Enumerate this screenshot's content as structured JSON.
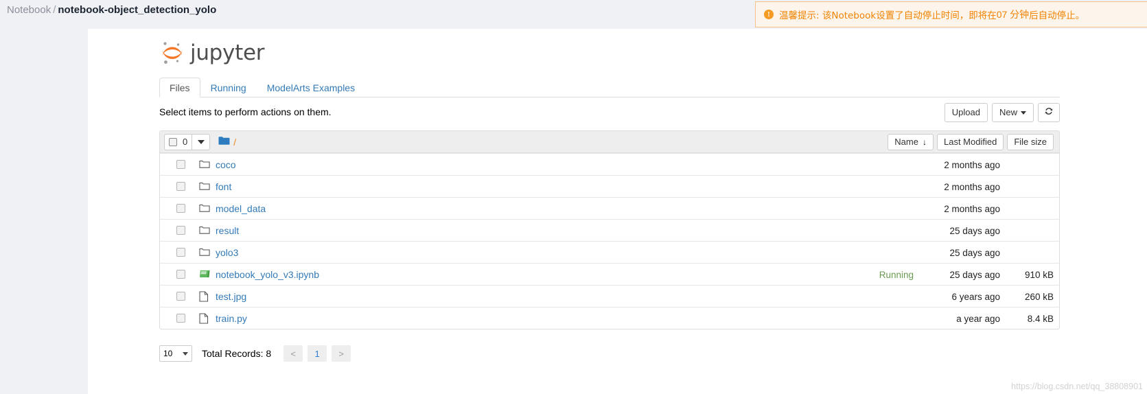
{
  "breadcrumb": {
    "root": "Notebook",
    "separator": "/",
    "current": "notebook-object_detection_yolo"
  },
  "notice": {
    "icon": "warning-exclamation-icon",
    "text_before": "温馨提示: 该Notebook设置了自动停止时间，即将在 ",
    "minutes": "07 分钟",
    "text_after": " 后自动停止。",
    "color": "#f08300",
    "background": "#fdf4ec",
    "border_color": "#f5c28b"
  },
  "brand": {
    "name": "jupyter",
    "logo_color": "#f37726",
    "dot_color": "#9e9e9e"
  },
  "tabs": [
    {
      "label": "Files",
      "active": true
    },
    {
      "label": "Running",
      "active": false
    },
    {
      "label": "ModelArts Examples",
      "active": false
    }
  ],
  "toolbar": {
    "select_hint": "Select items to perform actions on them.",
    "upload_label": "Upload",
    "new_label": "New",
    "refresh_icon": "refresh-icon"
  },
  "list_header": {
    "selected_count": "0",
    "path": "/",
    "folder_icon": "folder-filled-icon",
    "sort_name": "Name",
    "sort_name_arrow": "↓",
    "col_last_modified": "Last Modified",
    "col_file_size": "File size"
  },
  "files": [
    {
      "name": "coco",
      "type": "folder",
      "status": "",
      "modified": "2 months ago",
      "size": ""
    },
    {
      "name": "font",
      "type": "folder",
      "status": "",
      "modified": "2 months ago",
      "size": ""
    },
    {
      "name": "model_data",
      "type": "folder",
      "status": "",
      "modified": "2 months ago",
      "size": ""
    },
    {
      "name": "result",
      "type": "folder",
      "status": "",
      "modified": "25 days ago",
      "size": ""
    },
    {
      "name": "yolo3",
      "type": "folder",
      "status": "",
      "modified": "25 days ago",
      "size": ""
    },
    {
      "name": "notebook_yolo_v3.ipynb",
      "type": "notebook",
      "status": "Running",
      "modified": "25 days ago",
      "size": "910 kB"
    },
    {
      "name": "test.jpg",
      "type": "file",
      "status": "",
      "modified": "6 years ago",
      "size": "260 kB"
    },
    {
      "name": "train.py",
      "type": "file",
      "status": "",
      "modified": "a year ago",
      "size": "8.4 kB"
    }
  ],
  "pager": {
    "page_size": "10",
    "total_records": "Total Records: 8",
    "prev_label": "<",
    "current_page": "1",
    "next_label": ">"
  },
  "watermark": "https://blog.csdn.net/qq_38808901"
}
